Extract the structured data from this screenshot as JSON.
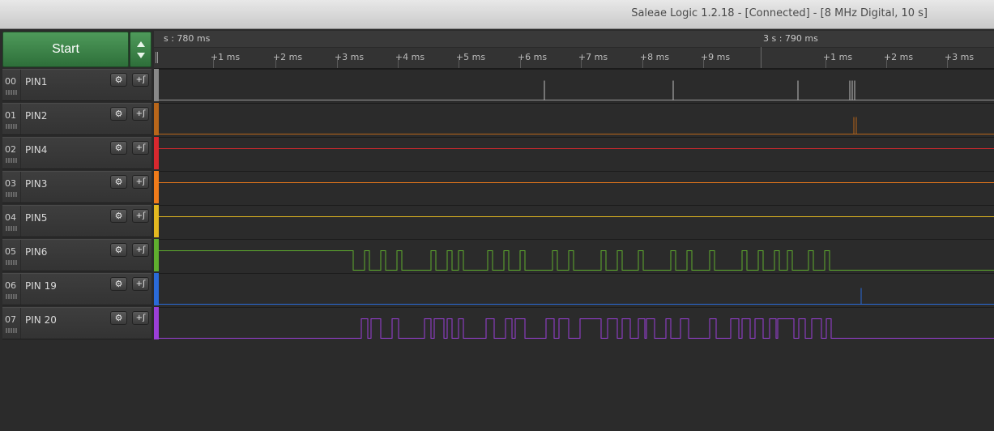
{
  "window": {
    "title": "Saleae Logic 1.2.18 - [Connected] - [8 MHz Digital, 10 s]"
  },
  "capture": {
    "start_label": "Start"
  },
  "timeline": {
    "left_label": "s : 780 ms",
    "right_label": "3 s : 790 ms",
    "ticks": [
      "+1 ms",
      "+2 ms",
      "+3 ms",
      "+4 ms",
      "+5 ms",
      "+6 ms",
      "+7 ms",
      "+8 ms",
      "+9 ms",
      "+1 ms",
      "+2 ms",
      "+3 ms"
    ]
  },
  "channels": [
    {
      "num": "00",
      "name": "PIN1",
      "color": "#888888",
      "wave": "pulses-white"
    },
    {
      "num": "01",
      "name": "PIN2",
      "color": "#b8661a",
      "wave": "pulses-brown"
    },
    {
      "num": "02",
      "name": "PIN4",
      "color": "#d8282e",
      "wave": "flat-high"
    },
    {
      "num": "03",
      "name": "PIN3",
      "color": "#f07b1a",
      "wave": "flat"
    },
    {
      "num": "04",
      "name": "PIN5",
      "color": "#e3b820",
      "wave": "flat"
    },
    {
      "num": "05",
      "name": "PIN6",
      "color": "#5fae2e",
      "wave": "data"
    },
    {
      "num": "06",
      "name": "PIN 19",
      "color": "#2a6ad8",
      "wave": "spike"
    },
    {
      "num": "07",
      "name": "PIN 20",
      "color": "#9b3fd8",
      "wave": "data"
    }
  ],
  "icons": {
    "gear": "gear-icon",
    "trigger": "trigger-edge-icon"
  }
}
